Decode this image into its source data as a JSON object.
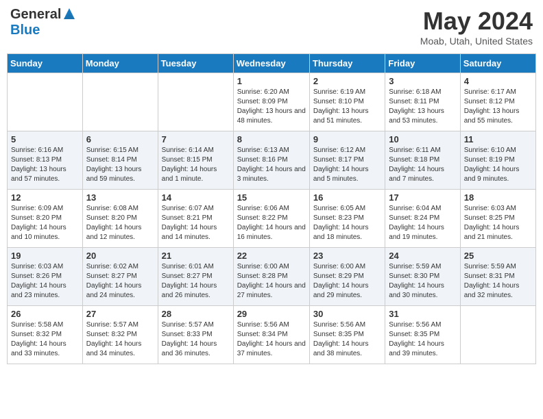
{
  "logo": {
    "general": "General",
    "blue": "Blue"
  },
  "title": "May 2024",
  "location": "Moab, Utah, United States",
  "days_of_week": [
    "Sunday",
    "Monday",
    "Tuesday",
    "Wednesday",
    "Thursday",
    "Friday",
    "Saturday"
  ],
  "weeks": [
    [
      {
        "day": "",
        "sunrise": "",
        "sunset": "",
        "daylight": ""
      },
      {
        "day": "",
        "sunrise": "",
        "sunset": "",
        "daylight": ""
      },
      {
        "day": "",
        "sunrise": "",
        "sunset": "",
        "daylight": ""
      },
      {
        "day": "1",
        "sunrise": "Sunrise: 6:20 AM",
        "sunset": "Sunset: 8:09 PM",
        "daylight": "Daylight: 13 hours and 48 minutes."
      },
      {
        "day": "2",
        "sunrise": "Sunrise: 6:19 AM",
        "sunset": "Sunset: 8:10 PM",
        "daylight": "Daylight: 13 hours and 51 minutes."
      },
      {
        "day": "3",
        "sunrise": "Sunrise: 6:18 AM",
        "sunset": "Sunset: 8:11 PM",
        "daylight": "Daylight: 13 hours and 53 minutes."
      },
      {
        "day": "4",
        "sunrise": "Sunrise: 6:17 AM",
        "sunset": "Sunset: 8:12 PM",
        "daylight": "Daylight: 13 hours and 55 minutes."
      }
    ],
    [
      {
        "day": "5",
        "sunrise": "Sunrise: 6:16 AM",
        "sunset": "Sunset: 8:13 PM",
        "daylight": "Daylight: 13 hours and 57 minutes."
      },
      {
        "day": "6",
        "sunrise": "Sunrise: 6:15 AM",
        "sunset": "Sunset: 8:14 PM",
        "daylight": "Daylight: 13 hours and 59 minutes."
      },
      {
        "day": "7",
        "sunrise": "Sunrise: 6:14 AM",
        "sunset": "Sunset: 8:15 PM",
        "daylight": "Daylight: 14 hours and 1 minute."
      },
      {
        "day": "8",
        "sunrise": "Sunrise: 6:13 AM",
        "sunset": "Sunset: 8:16 PM",
        "daylight": "Daylight: 14 hours and 3 minutes."
      },
      {
        "day": "9",
        "sunrise": "Sunrise: 6:12 AM",
        "sunset": "Sunset: 8:17 PM",
        "daylight": "Daylight: 14 hours and 5 minutes."
      },
      {
        "day": "10",
        "sunrise": "Sunrise: 6:11 AM",
        "sunset": "Sunset: 8:18 PM",
        "daylight": "Daylight: 14 hours and 7 minutes."
      },
      {
        "day": "11",
        "sunrise": "Sunrise: 6:10 AM",
        "sunset": "Sunset: 8:19 PM",
        "daylight": "Daylight: 14 hours and 9 minutes."
      }
    ],
    [
      {
        "day": "12",
        "sunrise": "Sunrise: 6:09 AM",
        "sunset": "Sunset: 8:20 PM",
        "daylight": "Daylight: 14 hours and 10 minutes."
      },
      {
        "day": "13",
        "sunrise": "Sunrise: 6:08 AM",
        "sunset": "Sunset: 8:20 PM",
        "daylight": "Daylight: 14 hours and 12 minutes."
      },
      {
        "day": "14",
        "sunrise": "Sunrise: 6:07 AM",
        "sunset": "Sunset: 8:21 PM",
        "daylight": "Daylight: 14 hours and 14 minutes."
      },
      {
        "day": "15",
        "sunrise": "Sunrise: 6:06 AM",
        "sunset": "Sunset: 8:22 PM",
        "daylight": "Daylight: 14 hours and 16 minutes."
      },
      {
        "day": "16",
        "sunrise": "Sunrise: 6:05 AM",
        "sunset": "Sunset: 8:23 PM",
        "daylight": "Daylight: 14 hours and 18 minutes."
      },
      {
        "day": "17",
        "sunrise": "Sunrise: 6:04 AM",
        "sunset": "Sunset: 8:24 PM",
        "daylight": "Daylight: 14 hours and 19 minutes."
      },
      {
        "day": "18",
        "sunrise": "Sunrise: 6:03 AM",
        "sunset": "Sunset: 8:25 PM",
        "daylight": "Daylight: 14 hours and 21 minutes."
      }
    ],
    [
      {
        "day": "19",
        "sunrise": "Sunrise: 6:03 AM",
        "sunset": "Sunset: 8:26 PM",
        "daylight": "Daylight: 14 hours and 23 minutes."
      },
      {
        "day": "20",
        "sunrise": "Sunrise: 6:02 AM",
        "sunset": "Sunset: 8:27 PM",
        "daylight": "Daylight: 14 hours and 24 minutes."
      },
      {
        "day": "21",
        "sunrise": "Sunrise: 6:01 AM",
        "sunset": "Sunset: 8:27 PM",
        "daylight": "Daylight: 14 hours and 26 minutes."
      },
      {
        "day": "22",
        "sunrise": "Sunrise: 6:00 AM",
        "sunset": "Sunset: 8:28 PM",
        "daylight": "Daylight: 14 hours and 27 minutes."
      },
      {
        "day": "23",
        "sunrise": "Sunrise: 6:00 AM",
        "sunset": "Sunset: 8:29 PM",
        "daylight": "Daylight: 14 hours and 29 minutes."
      },
      {
        "day": "24",
        "sunrise": "Sunrise: 5:59 AM",
        "sunset": "Sunset: 8:30 PM",
        "daylight": "Daylight: 14 hours and 30 minutes."
      },
      {
        "day": "25",
        "sunrise": "Sunrise: 5:59 AM",
        "sunset": "Sunset: 8:31 PM",
        "daylight": "Daylight: 14 hours and 32 minutes."
      }
    ],
    [
      {
        "day": "26",
        "sunrise": "Sunrise: 5:58 AM",
        "sunset": "Sunset: 8:32 PM",
        "daylight": "Daylight: 14 hours and 33 minutes."
      },
      {
        "day": "27",
        "sunrise": "Sunrise: 5:57 AM",
        "sunset": "Sunset: 8:32 PM",
        "daylight": "Daylight: 14 hours and 34 minutes."
      },
      {
        "day": "28",
        "sunrise": "Sunrise: 5:57 AM",
        "sunset": "Sunset: 8:33 PM",
        "daylight": "Daylight: 14 hours and 36 minutes."
      },
      {
        "day": "29",
        "sunrise": "Sunrise: 5:56 AM",
        "sunset": "Sunset: 8:34 PM",
        "daylight": "Daylight: 14 hours and 37 minutes."
      },
      {
        "day": "30",
        "sunrise": "Sunrise: 5:56 AM",
        "sunset": "Sunset: 8:35 PM",
        "daylight": "Daylight: 14 hours and 38 minutes."
      },
      {
        "day": "31",
        "sunrise": "Sunrise: 5:56 AM",
        "sunset": "Sunset: 8:35 PM",
        "daylight": "Daylight: 14 hours and 39 minutes."
      },
      {
        "day": "",
        "sunrise": "",
        "sunset": "",
        "daylight": ""
      }
    ]
  ]
}
